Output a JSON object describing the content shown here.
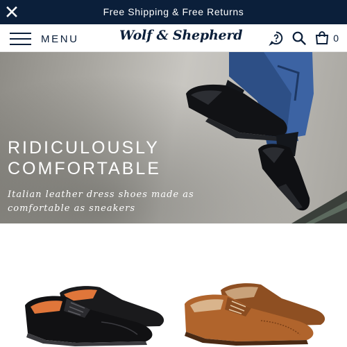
{
  "announcement": {
    "text": "Free Shipping & Free Returns",
    "close_icon": "close-icon"
  },
  "header": {
    "menu_label": "MENU",
    "logo_text": "Wolf & Shepherd",
    "cart_count": "0",
    "icons": [
      "help-chat-icon",
      "search-icon",
      "shopping-bag-icon"
    ]
  },
  "hero": {
    "title_line1": "RIDICULOUSLY",
    "title_line2": "COMFORTABLE",
    "subtitle": "Italian leather dress shoes made as comfortable as sneakers"
  },
  "products": [
    {
      "color": "#1c1c1c",
      "image": "black cap-toe oxford shoes"
    },
    {
      "color": "#a8622d",
      "image": "brown wingtip oxford shoes"
    }
  ],
  "colors": {
    "navy": "#0b1f3a",
    "white": "#ffffff"
  }
}
